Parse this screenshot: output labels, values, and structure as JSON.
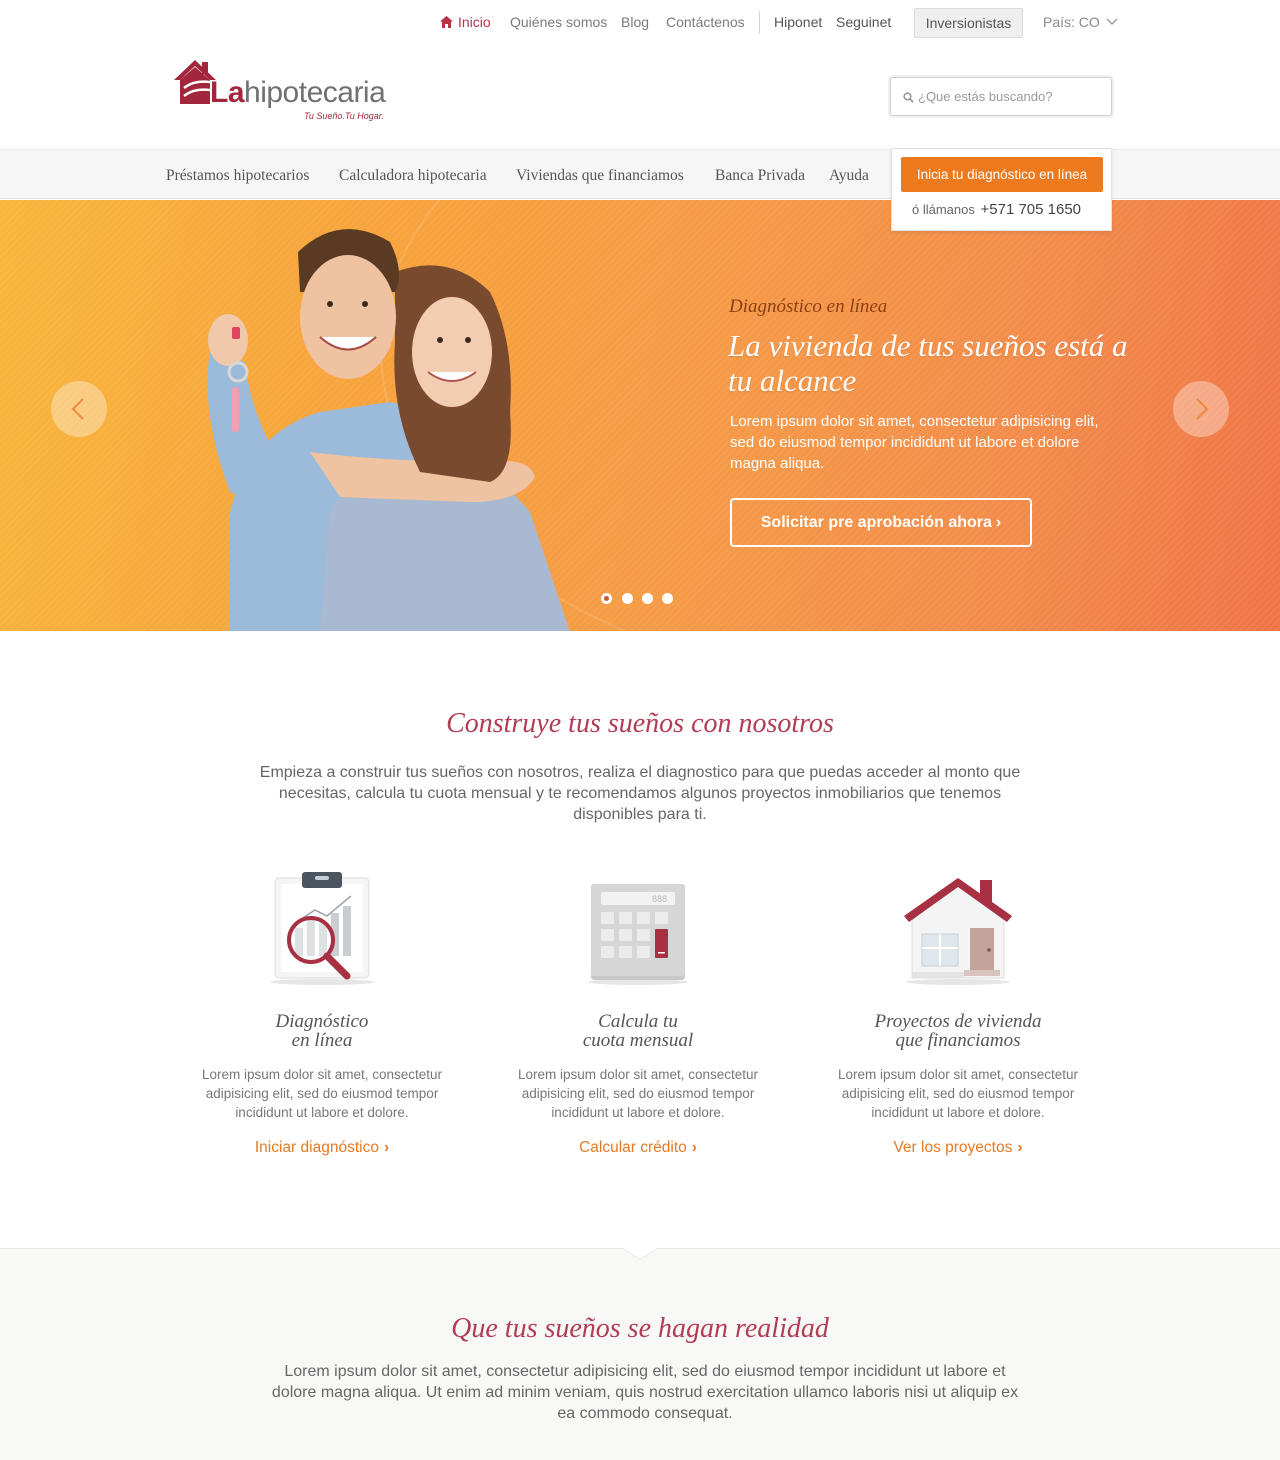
{
  "topbar": {
    "links": [
      "Inicio",
      "Quiénes somos",
      "Blog",
      "Contáctenos"
    ],
    "apps": [
      "Hiponet",
      "Seguinet"
    ],
    "investors_button": "Inversionistas",
    "country": "País: CO"
  },
  "logo": {
    "brand_bold": "La",
    "brand_rest": "hipotecaria",
    "tagline": "Tu Sueño.Tu Hogar."
  },
  "search": {
    "placeholder": "¿Que estás buscando?"
  },
  "nav": {
    "items": [
      "Préstamos hipotecarios",
      "Calculadora hipotecaria",
      "Viviendas que financiamos",
      "Banca Privada",
      "Ayuda"
    ]
  },
  "cta": {
    "button": "Inicia tu diagnóstico en línea",
    "call_prefix": "ó llámanos",
    "phone": "+571  705 1650"
  },
  "hero": {
    "kicker": "Diagnóstico en línea",
    "title": "La vivienda de tus sueños está a tu alcance",
    "text": "Lorem ipsum dolor sit amet, consectetur adipisicing elit, sed do eiusmod tempor incididunt ut labore et dolore magna aliqua.",
    "button": "Solicitar pre aprobación ahora",
    "slide_count": 4,
    "active_slide": 1
  },
  "section1": {
    "title": "Construye tus sueños con nosotros",
    "text": "Empieza a construir tus sueños con nosotros, realiza el diagnostico para que puedas acceder al monto que necesitas, calcula tu cuota mensual y te recomendamos algunos proyectos inmobiliarios que tenemos disponibles para ti.",
    "features": [
      {
        "icon": "clipboard-chart-magnifier-icon",
        "title": "Diagnóstico\nen línea",
        "text": "Lorem ipsum dolor sit amet, consectetur adipisicing elit, sed do eiusmod tempor incididunt ut labore et dolore.",
        "link": "Iniciar diagnóstico"
      },
      {
        "icon": "calculator-icon",
        "title": "Calcula tu\ncuota mensual",
        "text": "Lorem ipsum dolor sit amet, consectetur adipisicing elit, sed do eiusmod tempor incididunt ut labore et dolore.",
        "link": "Calcular crédito"
      },
      {
        "icon": "house-icon",
        "title": "Proyectos de vivienda\nque financiamos",
        "text": "Lorem ipsum dolor sit amet, consectetur adipisicing elit, sed do eiusmod tempor incididunt ut labore et dolore.",
        "link": "Ver los proyectos"
      }
    ]
  },
  "section2": {
    "title": "Que tus sueños se hagan realidad",
    "text": "Lorem ipsum dolor sit amet, consectetur adipisicing elit, sed do eiusmod tempor incididunt ut labore et dolore magna aliqua. Ut enim ad minim veniam, quis nostrud exercitation ullamco laboris nisi ut aliquip ex ea commodo consequat."
  },
  "colors": {
    "brand_red": "#a2273c",
    "heading_red": "#b23c55",
    "accent_orange": "#ef7a1d",
    "link_orange": "#e57a22"
  }
}
